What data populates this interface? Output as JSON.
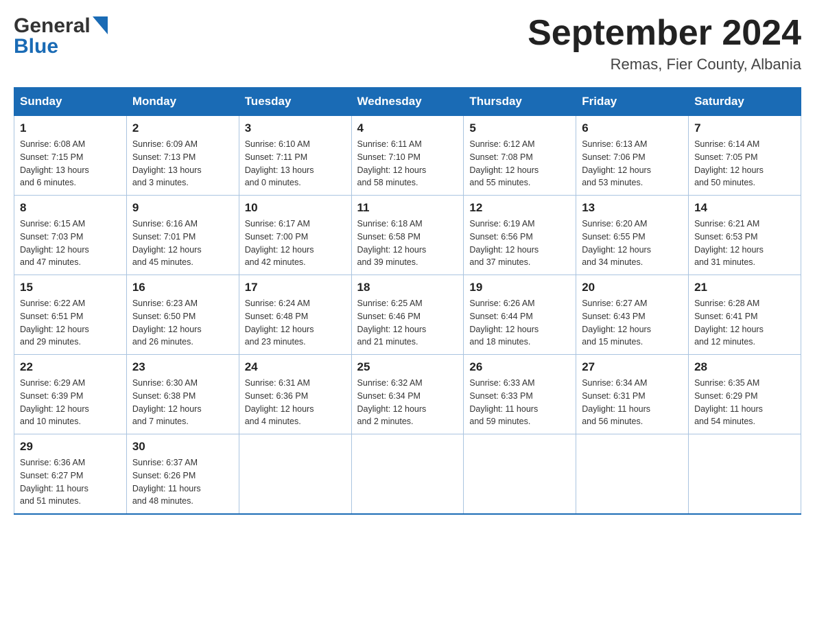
{
  "header": {
    "logo_line1": "General",
    "logo_line2": "Blue",
    "month_title": "September 2024",
    "location": "Remas, Fier County, Albania"
  },
  "days_of_week": [
    "Sunday",
    "Monday",
    "Tuesday",
    "Wednesday",
    "Thursday",
    "Friday",
    "Saturday"
  ],
  "weeks": [
    [
      {
        "day": "1",
        "info": "Sunrise: 6:08 AM\nSunset: 7:15 PM\nDaylight: 13 hours\nand 6 minutes."
      },
      {
        "day": "2",
        "info": "Sunrise: 6:09 AM\nSunset: 7:13 PM\nDaylight: 13 hours\nand 3 minutes."
      },
      {
        "day": "3",
        "info": "Sunrise: 6:10 AM\nSunset: 7:11 PM\nDaylight: 13 hours\nand 0 minutes."
      },
      {
        "day": "4",
        "info": "Sunrise: 6:11 AM\nSunset: 7:10 PM\nDaylight: 12 hours\nand 58 minutes."
      },
      {
        "day": "5",
        "info": "Sunrise: 6:12 AM\nSunset: 7:08 PM\nDaylight: 12 hours\nand 55 minutes."
      },
      {
        "day": "6",
        "info": "Sunrise: 6:13 AM\nSunset: 7:06 PM\nDaylight: 12 hours\nand 53 minutes."
      },
      {
        "day": "7",
        "info": "Sunrise: 6:14 AM\nSunset: 7:05 PM\nDaylight: 12 hours\nand 50 minutes."
      }
    ],
    [
      {
        "day": "8",
        "info": "Sunrise: 6:15 AM\nSunset: 7:03 PM\nDaylight: 12 hours\nand 47 minutes."
      },
      {
        "day": "9",
        "info": "Sunrise: 6:16 AM\nSunset: 7:01 PM\nDaylight: 12 hours\nand 45 minutes."
      },
      {
        "day": "10",
        "info": "Sunrise: 6:17 AM\nSunset: 7:00 PM\nDaylight: 12 hours\nand 42 minutes."
      },
      {
        "day": "11",
        "info": "Sunrise: 6:18 AM\nSunset: 6:58 PM\nDaylight: 12 hours\nand 39 minutes."
      },
      {
        "day": "12",
        "info": "Sunrise: 6:19 AM\nSunset: 6:56 PM\nDaylight: 12 hours\nand 37 minutes."
      },
      {
        "day": "13",
        "info": "Sunrise: 6:20 AM\nSunset: 6:55 PM\nDaylight: 12 hours\nand 34 minutes."
      },
      {
        "day": "14",
        "info": "Sunrise: 6:21 AM\nSunset: 6:53 PM\nDaylight: 12 hours\nand 31 minutes."
      }
    ],
    [
      {
        "day": "15",
        "info": "Sunrise: 6:22 AM\nSunset: 6:51 PM\nDaylight: 12 hours\nand 29 minutes."
      },
      {
        "day": "16",
        "info": "Sunrise: 6:23 AM\nSunset: 6:50 PM\nDaylight: 12 hours\nand 26 minutes."
      },
      {
        "day": "17",
        "info": "Sunrise: 6:24 AM\nSunset: 6:48 PM\nDaylight: 12 hours\nand 23 minutes."
      },
      {
        "day": "18",
        "info": "Sunrise: 6:25 AM\nSunset: 6:46 PM\nDaylight: 12 hours\nand 21 minutes."
      },
      {
        "day": "19",
        "info": "Sunrise: 6:26 AM\nSunset: 6:44 PM\nDaylight: 12 hours\nand 18 minutes."
      },
      {
        "day": "20",
        "info": "Sunrise: 6:27 AM\nSunset: 6:43 PM\nDaylight: 12 hours\nand 15 minutes."
      },
      {
        "day": "21",
        "info": "Sunrise: 6:28 AM\nSunset: 6:41 PM\nDaylight: 12 hours\nand 12 minutes."
      }
    ],
    [
      {
        "day": "22",
        "info": "Sunrise: 6:29 AM\nSunset: 6:39 PM\nDaylight: 12 hours\nand 10 minutes."
      },
      {
        "day": "23",
        "info": "Sunrise: 6:30 AM\nSunset: 6:38 PM\nDaylight: 12 hours\nand 7 minutes."
      },
      {
        "day": "24",
        "info": "Sunrise: 6:31 AM\nSunset: 6:36 PM\nDaylight: 12 hours\nand 4 minutes."
      },
      {
        "day": "25",
        "info": "Sunrise: 6:32 AM\nSunset: 6:34 PM\nDaylight: 12 hours\nand 2 minutes."
      },
      {
        "day": "26",
        "info": "Sunrise: 6:33 AM\nSunset: 6:33 PM\nDaylight: 11 hours\nand 59 minutes."
      },
      {
        "day": "27",
        "info": "Sunrise: 6:34 AM\nSunset: 6:31 PM\nDaylight: 11 hours\nand 56 minutes."
      },
      {
        "day": "28",
        "info": "Sunrise: 6:35 AM\nSunset: 6:29 PM\nDaylight: 11 hours\nand 54 minutes."
      }
    ],
    [
      {
        "day": "29",
        "info": "Sunrise: 6:36 AM\nSunset: 6:27 PM\nDaylight: 11 hours\nand 51 minutes."
      },
      {
        "day": "30",
        "info": "Sunrise: 6:37 AM\nSunset: 6:26 PM\nDaylight: 11 hours\nand 48 minutes."
      },
      {
        "day": "",
        "info": ""
      },
      {
        "day": "",
        "info": ""
      },
      {
        "day": "",
        "info": ""
      },
      {
        "day": "",
        "info": ""
      },
      {
        "day": "",
        "info": ""
      }
    ]
  ]
}
